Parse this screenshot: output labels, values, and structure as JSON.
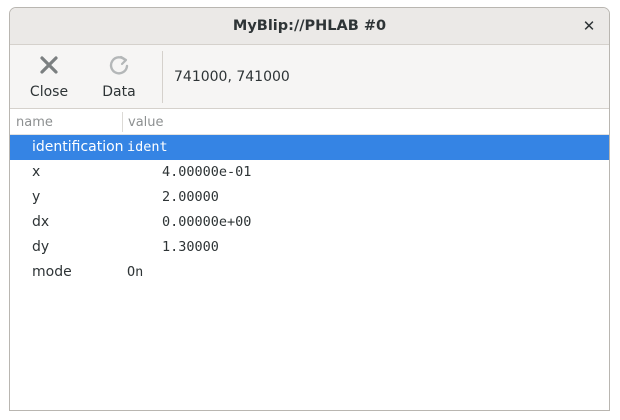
{
  "window": {
    "title": "MyBlip://PHLAB #0",
    "close_glyph": "✕"
  },
  "toolbar": {
    "close_label": "Close",
    "close_icon": "close-x-icon",
    "data_label": "Data",
    "data_icon": "refresh-icon",
    "coords_text": "741000, 741000"
  },
  "table": {
    "headers": {
      "name": "name",
      "value": "value"
    },
    "rows": [
      {
        "name": "identification",
        "value": "ident",
        "selected": true
      },
      {
        "name": "x",
        "value": "4.00000e-01"
      },
      {
        "name": "y",
        "value": "2.00000"
      },
      {
        "name": "dx",
        "value": "0.00000e+00"
      },
      {
        "name": "dy",
        "value": "1.30000"
      },
      {
        "name": "mode",
        "value": "On"
      }
    ]
  },
  "colors": {
    "selection": "#3584e4",
    "titlebar": "#ebe9e7",
    "toolbar": "#f6f5f4",
    "text": "#2e3436"
  }
}
